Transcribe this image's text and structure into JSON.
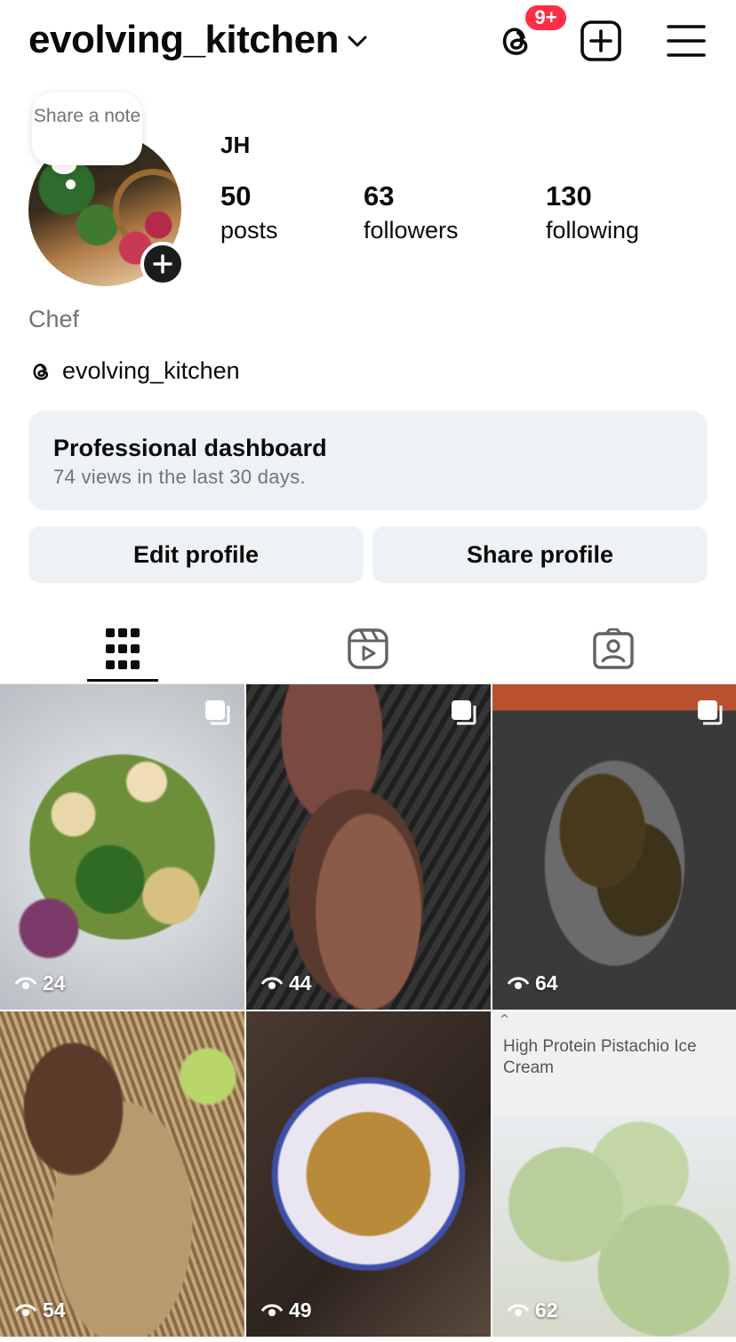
{
  "header": {
    "username": "evolving_kitchen",
    "notification_badge": "9+",
    "icons": {
      "threads": "threads-icon",
      "create": "plus-square-icon",
      "menu": "hamburger-menu-icon"
    }
  },
  "profile": {
    "note_prompt": "Share a note",
    "display_name": "JH",
    "stats": [
      {
        "value": "50",
        "label": "posts"
      },
      {
        "value": "63",
        "label": "followers"
      },
      {
        "value": "130",
        "label": "following"
      }
    ],
    "bio": "Chef",
    "threads_handle": "evolving_kitchen"
  },
  "dashboard": {
    "title": "Professional dashboard",
    "subtitle": "74 views in the last 30 days."
  },
  "actions": {
    "edit_label": "Edit profile",
    "share_label": "Share profile"
  },
  "tabs": [
    "grid-icon",
    "reels-icon",
    "tagged-icon"
  ],
  "posts": [
    {
      "views": "24",
      "multi": true
    },
    {
      "views": "44",
      "multi": true
    },
    {
      "views": "64",
      "multi": true
    },
    {
      "views": "54",
      "multi": false
    },
    {
      "views": "49",
      "multi": false
    },
    {
      "views": "62",
      "multi": false,
      "title": "High Protein Pistachio Ice Cream"
    }
  ],
  "colors": {
    "badge": "#ff2d46",
    "card_bg": "#eff2f5",
    "muted_text": "#737373"
  }
}
